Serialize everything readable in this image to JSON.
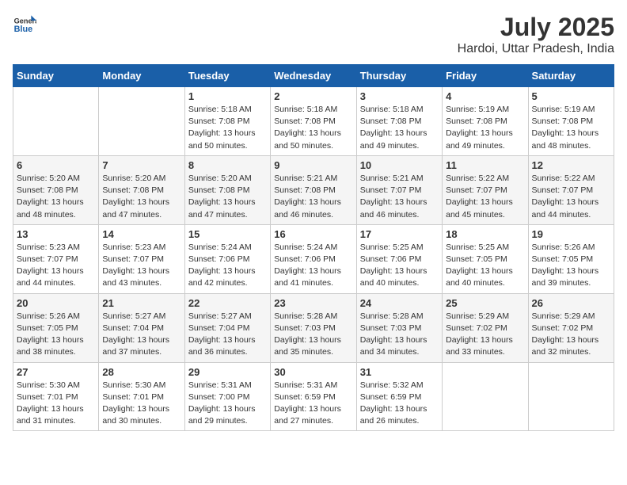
{
  "logo": {
    "text_general": "General",
    "text_blue": "Blue"
  },
  "title": "July 2025",
  "subtitle": "Hardoi, Uttar Pradesh, India",
  "header_days": [
    "Sunday",
    "Monday",
    "Tuesday",
    "Wednesday",
    "Thursday",
    "Friday",
    "Saturday"
  ],
  "weeks": [
    [
      {
        "day": "",
        "info": ""
      },
      {
        "day": "",
        "info": ""
      },
      {
        "day": "1",
        "info": "Sunrise: 5:18 AM\nSunset: 7:08 PM\nDaylight: 13 hours\nand 50 minutes."
      },
      {
        "day": "2",
        "info": "Sunrise: 5:18 AM\nSunset: 7:08 PM\nDaylight: 13 hours\nand 50 minutes."
      },
      {
        "day": "3",
        "info": "Sunrise: 5:18 AM\nSunset: 7:08 PM\nDaylight: 13 hours\nand 49 minutes."
      },
      {
        "day": "4",
        "info": "Sunrise: 5:19 AM\nSunset: 7:08 PM\nDaylight: 13 hours\nand 49 minutes."
      },
      {
        "day": "5",
        "info": "Sunrise: 5:19 AM\nSunset: 7:08 PM\nDaylight: 13 hours\nand 48 minutes."
      }
    ],
    [
      {
        "day": "6",
        "info": "Sunrise: 5:20 AM\nSunset: 7:08 PM\nDaylight: 13 hours\nand 48 minutes."
      },
      {
        "day": "7",
        "info": "Sunrise: 5:20 AM\nSunset: 7:08 PM\nDaylight: 13 hours\nand 47 minutes."
      },
      {
        "day": "8",
        "info": "Sunrise: 5:20 AM\nSunset: 7:08 PM\nDaylight: 13 hours\nand 47 minutes."
      },
      {
        "day": "9",
        "info": "Sunrise: 5:21 AM\nSunset: 7:08 PM\nDaylight: 13 hours\nand 46 minutes."
      },
      {
        "day": "10",
        "info": "Sunrise: 5:21 AM\nSunset: 7:07 PM\nDaylight: 13 hours\nand 46 minutes."
      },
      {
        "day": "11",
        "info": "Sunrise: 5:22 AM\nSunset: 7:07 PM\nDaylight: 13 hours\nand 45 minutes."
      },
      {
        "day": "12",
        "info": "Sunrise: 5:22 AM\nSunset: 7:07 PM\nDaylight: 13 hours\nand 44 minutes."
      }
    ],
    [
      {
        "day": "13",
        "info": "Sunrise: 5:23 AM\nSunset: 7:07 PM\nDaylight: 13 hours\nand 44 minutes."
      },
      {
        "day": "14",
        "info": "Sunrise: 5:23 AM\nSunset: 7:07 PM\nDaylight: 13 hours\nand 43 minutes."
      },
      {
        "day": "15",
        "info": "Sunrise: 5:24 AM\nSunset: 7:06 PM\nDaylight: 13 hours\nand 42 minutes."
      },
      {
        "day": "16",
        "info": "Sunrise: 5:24 AM\nSunset: 7:06 PM\nDaylight: 13 hours\nand 41 minutes."
      },
      {
        "day": "17",
        "info": "Sunrise: 5:25 AM\nSunset: 7:06 PM\nDaylight: 13 hours\nand 40 minutes."
      },
      {
        "day": "18",
        "info": "Sunrise: 5:25 AM\nSunset: 7:05 PM\nDaylight: 13 hours\nand 40 minutes."
      },
      {
        "day": "19",
        "info": "Sunrise: 5:26 AM\nSunset: 7:05 PM\nDaylight: 13 hours\nand 39 minutes."
      }
    ],
    [
      {
        "day": "20",
        "info": "Sunrise: 5:26 AM\nSunset: 7:05 PM\nDaylight: 13 hours\nand 38 minutes."
      },
      {
        "day": "21",
        "info": "Sunrise: 5:27 AM\nSunset: 7:04 PM\nDaylight: 13 hours\nand 37 minutes."
      },
      {
        "day": "22",
        "info": "Sunrise: 5:27 AM\nSunset: 7:04 PM\nDaylight: 13 hours\nand 36 minutes."
      },
      {
        "day": "23",
        "info": "Sunrise: 5:28 AM\nSunset: 7:03 PM\nDaylight: 13 hours\nand 35 minutes."
      },
      {
        "day": "24",
        "info": "Sunrise: 5:28 AM\nSunset: 7:03 PM\nDaylight: 13 hours\nand 34 minutes."
      },
      {
        "day": "25",
        "info": "Sunrise: 5:29 AM\nSunset: 7:02 PM\nDaylight: 13 hours\nand 33 minutes."
      },
      {
        "day": "26",
        "info": "Sunrise: 5:29 AM\nSunset: 7:02 PM\nDaylight: 13 hours\nand 32 minutes."
      }
    ],
    [
      {
        "day": "27",
        "info": "Sunrise: 5:30 AM\nSunset: 7:01 PM\nDaylight: 13 hours\nand 31 minutes."
      },
      {
        "day": "28",
        "info": "Sunrise: 5:30 AM\nSunset: 7:01 PM\nDaylight: 13 hours\nand 30 minutes."
      },
      {
        "day": "29",
        "info": "Sunrise: 5:31 AM\nSunset: 7:00 PM\nDaylight: 13 hours\nand 29 minutes."
      },
      {
        "day": "30",
        "info": "Sunrise: 5:31 AM\nSunset: 6:59 PM\nDaylight: 13 hours\nand 27 minutes."
      },
      {
        "day": "31",
        "info": "Sunrise: 5:32 AM\nSunset: 6:59 PM\nDaylight: 13 hours\nand 26 minutes."
      },
      {
        "day": "",
        "info": ""
      },
      {
        "day": "",
        "info": ""
      }
    ]
  ]
}
